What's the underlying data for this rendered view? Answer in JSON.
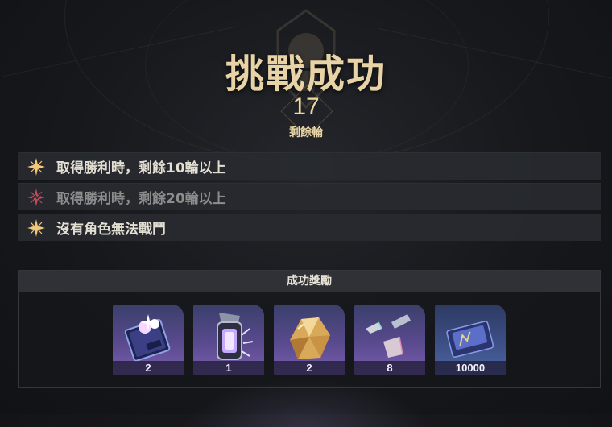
{
  "header": {
    "title": "挑戰成功",
    "turns_value": "17",
    "turns_label": "剩餘輪"
  },
  "conditions": [
    {
      "text": "取得勝利時，剩餘10輪以上",
      "achieved": true
    },
    {
      "text": "取得勝利時，剩餘20輪以上",
      "achieved": false
    },
    {
      "text": "沒有角色無法戰鬥",
      "achieved": true
    }
  ],
  "rewards": {
    "header": "成功獎勵",
    "items": [
      {
        "icon": "book-icon",
        "count": "2"
      },
      {
        "icon": "lantern-icon",
        "count": "1"
      },
      {
        "icon": "gold-crystal-icon",
        "count": "2"
      },
      {
        "icon": "shards-icon",
        "count": "8"
      },
      {
        "icon": "currency-card-icon",
        "count": "10000"
      }
    ]
  },
  "colors": {
    "title": "#e7d3a6",
    "star_gold": "#f2c878",
    "star_failed": "#c84a5a"
  }
}
